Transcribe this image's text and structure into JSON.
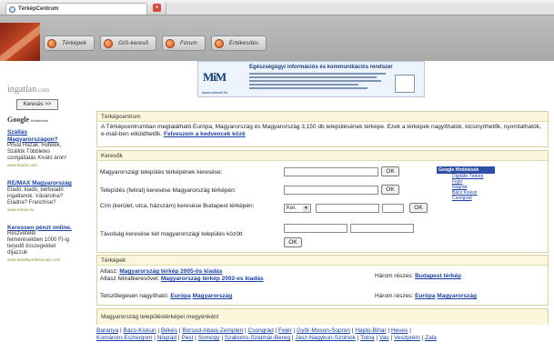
{
  "browser": {
    "tab_title": "TérképCentrum"
  },
  "header": {
    "nav": [
      {
        "label": "Térképek"
      },
      {
        "label": "GIS-kereső"
      },
      {
        "label": "Fórum"
      },
      {
        "label": "Értékesítés"
      }
    ]
  },
  "sidebar": {
    "brand_main": "ingatlan",
    "brand_ext": ".com",
    "search_button": "Keresés >>",
    "google_label": "Google",
    "google_sub": "Hirdetések",
    "ads": [
      {
        "title": "Szállás Magyarországon?",
        "body": "Privát Házak, Hotelek, Szállók Többletes szolgáltatás Kiváló áron!",
        "url": "www.fotoba.com"
      },
      {
        "title": "RE/MAX Magyarország",
        "body": "Eladó, kiadó, bérbeadó ingatlanok. Vásárolna? Eladna? Franchise?",
        "url": "www.remax.hu"
      },
      {
        "title": "Keressen pénzt online.",
        "body": "Részvételét felmérésekben 1000 Ft-ig terjedő összegekkel díjazzuk",
        "url": "www.adsafeprofesionals.com"
      }
    ]
  },
  "banner": {
    "logo": "MiM",
    "url": "www.mimnet.hu",
    "headline": "Egészségügyi információs és kommunikációs rendszer"
  },
  "panels": {
    "intro_title": "Térképcentrum",
    "intro_text": "A Térképcentrumban megtalálható Európa, Magyarország és Magyarország 3,150 db településének térképe. Ezek a térképek nagyíthatók, kicsinyíthetők, nyomtathatók, e-mail-ben elküldhetők.",
    "intro_link": "Felveszem a kedvencek közé",
    "search_title": "Keresők",
    "maps_title": "Térképek",
    "settlements_title": "Magyarország településtérképei megyénként"
  },
  "search_form": {
    "q1_label": "Magyarországi település térképének keresése:",
    "q2_label": "Település (felirat) keresése Magyarország térképén:",
    "q3_label": "Cím (kerület, utca, házszám) keresése Budapest térképén:",
    "q3_select": "Ker.",
    "q4_label": "Távolság keresése két magyarországi település között",
    "ok": "OK"
  },
  "google_ads_box": {
    "title": "Google Hirdetések",
    "links": [
      "Digitális Térkép",
      "Fejér",
      "Nógrád",
      "Bács Kiskun",
      "Csongrád"
    ]
  },
  "maps": {
    "atlasz_label": "Atlasz:",
    "atlasz_link": "Magyarország térkép 2005-ös kiadás",
    "felirat_label": "Atlasz feliratkeresővel:",
    "felirat_link": "Magyarország térkép 2002-es kiadás",
    "harom1_label": "Három részes:",
    "harom1_link": "Budapest térkép",
    "tetsz_label": "Tetszőlegesen nagyítható:",
    "tetsz_link1": "Európa",
    "tetsz_link2": "Magyarország",
    "harom2_label": "Három részes:",
    "harom2_link1": "Európa",
    "harom2_link2": "Magyarország"
  },
  "counties": [
    "Baranya",
    "Bács-Kiskun",
    "Békés",
    "Borsod-Abaúj-Zemplén",
    "Csongrád",
    "Fejér",
    "Győr-Moson-Sopron",
    "Hajdú-Bihar",
    "Heves",
    "Komárom-Esztergom",
    "Nógrád",
    "Pest",
    "Somogy",
    "Szabolcs-Szatmár-Bereg",
    "Jász-Nagykun-Szolnok",
    "Tolna",
    "Vas",
    "Veszprém",
    "Zala"
  ]
}
